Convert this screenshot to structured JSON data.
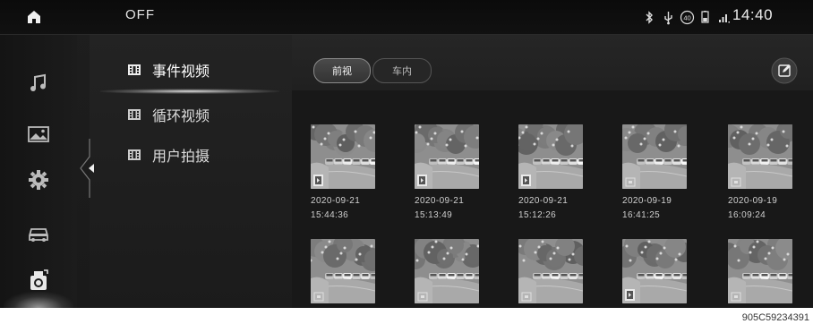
{
  "status_bar": {
    "mode": "OFF",
    "time": "14:40",
    "icons": [
      "bluetooth-icon",
      "usb-icon",
      "speed-40-icon",
      "battery-icon",
      "signal-icon"
    ],
    "speed_badge": "40"
  },
  "rail": {
    "items": [
      "music-icon",
      "gallery-icon",
      "settings-icon",
      "car-icon",
      "dvr-camera-icon"
    ],
    "active_index": 4
  },
  "categories": {
    "items": [
      {
        "label": "事件视频",
        "icon": "film-icon"
      },
      {
        "label": "循环视频",
        "icon": "film-icon"
      },
      {
        "label": "用户拍摄",
        "icon": "film-icon"
      }
    ],
    "active_index": 0
  },
  "toolbar": {
    "tabs": [
      "前视",
      "车内"
    ],
    "active_tab": 0,
    "edit_icon": "edit-icon"
  },
  "grid": {
    "row1": [
      {
        "date": "2020-09-21",
        "time": "15:44:36",
        "type_icon": "video-badge-icon"
      },
      {
        "date": "2020-09-21",
        "time": "15:13:49",
        "type_icon": "video-badge-icon"
      },
      {
        "date": "2020-09-21",
        "time": "15:12:26",
        "type_icon": "video-badge-icon"
      },
      {
        "date": "2020-09-19",
        "time": "16:41:25",
        "type_icon": "photo-badge-icon"
      },
      {
        "date": "2020-09-19",
        "time": "16:09:24",
        "type_icon": "photo-badge-icon"
      }
    ],
    "row2_count": 5
  },
  "watermark": "905C59234391",
  "colors": {
    "background": "#1a1a1a",
    "text": "#dcdcdc",
    "accent": "#ffffff"
  }
}
